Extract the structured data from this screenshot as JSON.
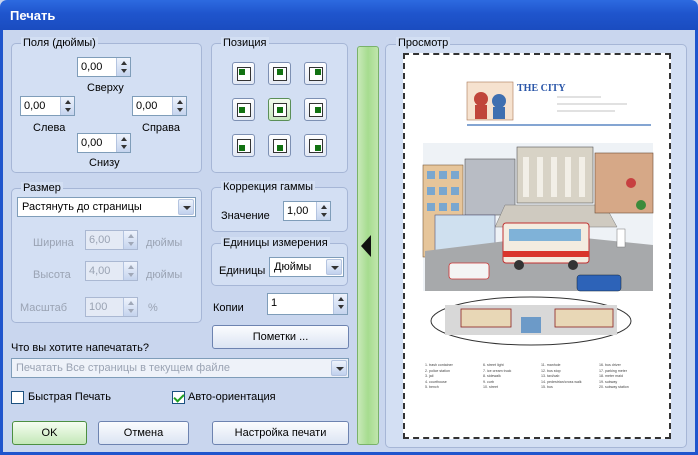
{
  "window": {
    "title": "Печать"
  },
  "margins": {
    "title": "Поля (дюймы)",
    "top": {
      "label": "Сверху",
      "value": "0,00"
    },
    "left": {
      "label": "Слева",
      "value": "0,00"
    },
    "right": {
      "label": "Справа",
      "value": "0,00"
    },
    "bottom": {
      "label": "Снизу",
      "value": "0,00"
    }
  },
  "position": {
    "title": "Позиция",
    "selected": "center"
  },
  "size": {
    "title": "Размер",
    "mode": "Растянуть до страницы",
    "width": {
      "label": "Ширина",
      "value": "6,00",
      "unit": "дюймы"
    },
    "height": {
      "label": "Высота",
      "value": "4,00",
      "unit": "дюймы"
    },
    "scale": {
      "label": "Масштаб",
      "value": "100",
      "unit": "%"
    }
  },
  "gamma": {
    "title": "Коррекция гаммы",
    "label": "Значение",
    "value": "1,00"
  },
  "units": {
    "title": "Единицы измерения",
    "label": "Единицы",
    "value": "Дюймы"
  },
  "copies": {
    "label": "Копии",
    "value": "1"
  },
  "marks_button": "Пометки ...",
  "print_what": {
    "label": "Что вы хотите напечатать?",
    "value": "Печатать Все страницы в текущем файле"
  },
  "fast_print": {
    "label": "Быстрая Печать",
    "checked": false
  },
  "auto_orient": {
    "label": "Авто-ориентация",
    "checked": true
  },
  "buttons": {
    "ok": "OK",
    "cancel": "Отмена",
    "setup": "Настройка печати"
  },
  "preview": {
    "title": "Просмотр",
    "page_title": "THE CITY",
    "vocab": [
      [
        "1. trash container",
        "2. police station",
        "3. jail",
        "4. courthouse",
        "5. bench"
      ],
      [
        "6. street light",
        "7. ice cream truck",
        "8. sidewalk",
        "9. curb",
        "10. street"
      ],
      [
        "11. manhole",
        "12. bus stop",
        "13. taxi/cab",
        "14. pedestrian/cross walk",
        "15. bus"
      ],
      [
        "16. bus driver",
        "17. parking meter",
        "18. meter maid",
        "19. subway",
        "20. subway station"
      ]
    ]
  }
}
